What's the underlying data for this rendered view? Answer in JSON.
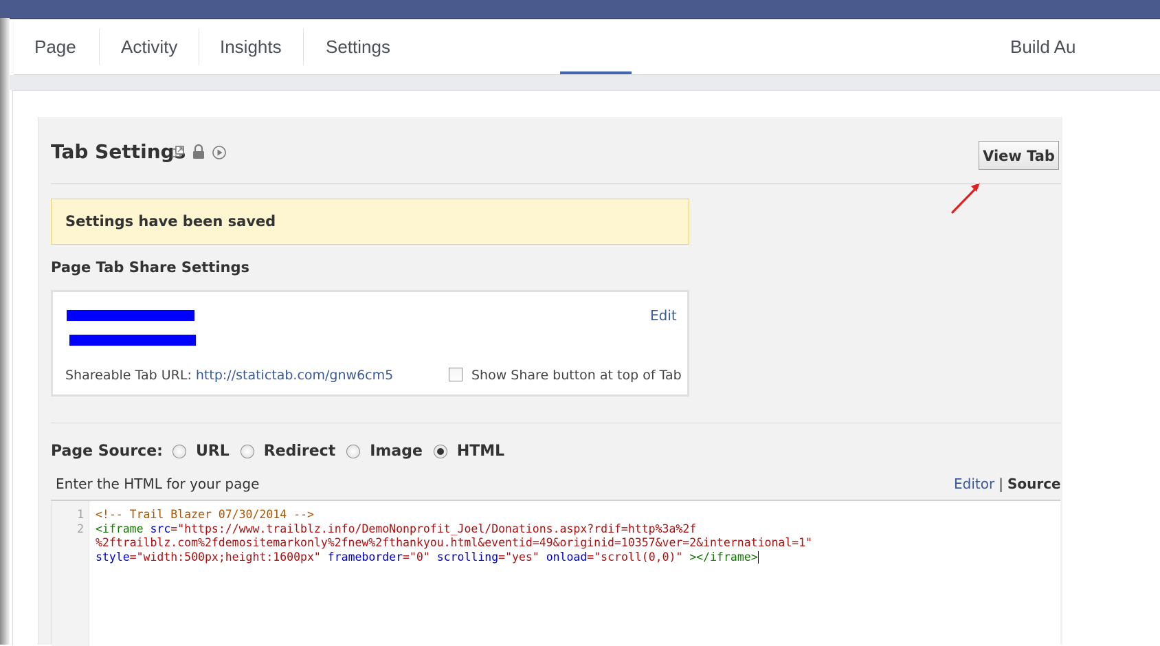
{
  "nav": {
    "tabs": [
      "Page",
      "Activity",
      "Insights",
      "Settings"
    ],
    "right_tab": "Build Au"
  },
  "tab_settings": {
    "title": "Tab Settings",
    "icons": [
      "external-window-icon",
      "lock-icon",
      "play-circle-icon"
    ],
    "view_tab_button": "View Tab"
  },
  "alert": {
    "message": "Settings have been saved"
  },
  "share_settings": {
    "title": "Page Tab Share Settings",
    "edit_label": "Edit",
    "shareable_label": "Shareable Tab URL:",
    "shareable_url": "http://statictab.com/gnw6cm5",
    "show_share_checkbox_label": "Show Share button at top of Tab",
    "show_share_checked": false
  },
  "page_source": {
    "label": "Page Source:",
    "options": [
      "URL",
      "Redirect",
      "Image",
      "HTML"
    ],
    "selected": "HTML"
  },
  "html_editor": {
    "instruction": "Enter the HTML for your page",
    "mode_editor": "Editor",
    "mode_separator": "|",
    "mode_source": "Source",
    "line_numbers": [
      "1",
      "2"
    ],
    "code_line1": "<!-- Trail Blazer 07/30/2014 -->",
    "code_line2_tag_open": "<iframe",
    "code_line2_attr_src": "src",
    "code_line2_src_value": "\"https://www.trailblz.info/DemoNonprofit_Joel/Donations.aspx?rdif=http%3a%2f",
    "code_line2_wrap1": "%2ftrailblz.com%2fdemositemarkonly%2fnew%2fthankyou.html&eventid=49&originid=10357&ver=2&international=1\"",
    "code_line2_attr_style": "style",
    "code_line2_style_value": "\"width:500px;height:1600px\"",
    "code_line2_attr_frameborder": "frameborder",
    "code_line2_frameborder_value": "\"0\"",
    "code_line2_attr_scrolling": "scrolling",
    "code_line2_scrolling_value": "\"yes\"",
    "code_line2_attr_onload": "onload",
    "code_line2_onload_value": "\"scroll(0,0)\"",
    "code_line2_tag_close": "></iframe>"
  },
  "colors": {
    "link": "#3b5998",
    "nav_active": "#4267b2",
    "alert_bg": "#fdf6d1",
    "alert_border": "#e4cf72",
    "redaction": "#0000ff",
    "annotation_arrow": "#e02020"
  }
}
